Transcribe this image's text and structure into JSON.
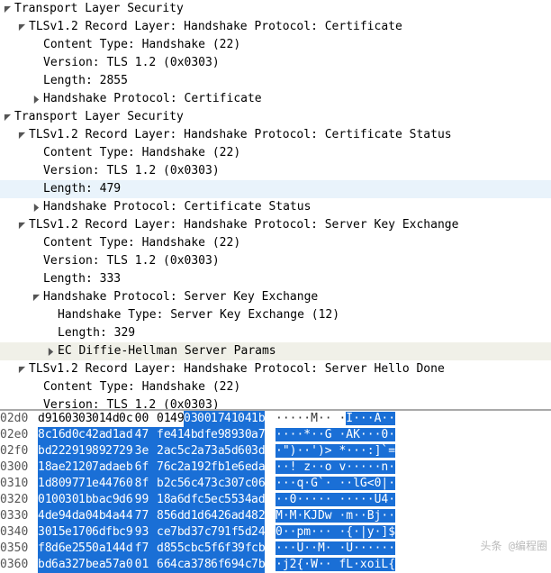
{
  "tree": {
    "n1": {
      "label": "Transport Layer Security"
    },
    "n1_1": {
      "label": "TLSv1.2 Record Layer: Handshake Protocol: Certificate"
    },
    "n1_1_ct": {
      "label": "Content Type: Handshake (22)"
    },
    "n1_1_ver": {
      "label": "Version: TLS 1.2 (0x0303)"
    },
    "n1_1_len": {
      "label": "Length: 2855"
    },
    "n1_1_hp": {
      "label": "Handshake Protocol: Certificate"
    },
    "n2": {
      "label": "Transport Layer Security"
    },
    "n2_1": {
      "label": "TLSv1.2 Record Layer: Handshake Protocol: Certificate Status"
    },
    "n2_1_ct": {
      "label": "Content Type: Handshake (22)"
    },
    "n2_1_ver": {
      "label": "Version: TLS 1.2 (0x0303)"
    },
    "n2_1_len": {
      "label": "Length: 479"
    },
    "n2_1_hp": {
      "label": "Handshake Protocol: Certificate Status"
    },
    "n2_2": {
      "label": "TLSv1.2 Record Layer: Handshake Protocol: Server Key Exchange"
    },
    "n2_2_ct": {
      "label": "Content Type: Handshake (22)"
    },
    "n2_2_ver": {
      "label": "Version: TLS 1.2 (0x0303)"
    },
    "n2_2_len": {
      "label": "Length: 333"
    },
    "n2_2_hp": {
      "label": "Handshake Protocol: Server Key Exchange"
    },
    "n2_2_ht": {
      "label": "Handshake Type: Server Key Exchange (12)"
    },
    "n2_2_hplen": {
      "label": "Length: 329"
    },
    "n2_2_ecdh": {
      "label": "EC Diffie-Hellman Server Params"
    },
    "n2_3": {
      "label": "TLSv1.2 Record Layer: Handshake Protocol: Server Hello Done"
    },
    "n2_3_ct": {
      "label": "Content Type: Handshake (22)"
    },
    "n2_3_ver": {
      "label": "Version: TLS 1.2 (0x0303)"
    }
  },
  "hex": {
    "r02d0": {
      "off": "02d0",
      "b": [
        "d9",
        "16",
        "03",
        "03",
        "01",
        "4d",
        "0c",
        "00",
        "01",
        "49",
        "03",
        "00",
        "17",
        "41",
        "04",
        "1b"
      ],
      "a": "·····M·· ·I···A··",
      "sel_from": 10
    },
    "r02e0": {
      "off": "02e0",
      "b": [
        "8c",
        "16",
        "d0",
        "c4",
        "2a",
        "d1",
        "ad",
        "47",
        "fe",
        "41",
        "4b",
        "df",
        "e9",
        "89",
        "30",
        "a7"
      ],
      "a": "····*··G ·AK···0·",
      "sel_from": 0
    },
    "r02f0": {
      "off": "02f0",
      "b": [
        "bd",
        "22",
        "29",
        "19",
        "89",
        "27",
        "29",
        "3e",
        "2a",
        "c5",
        "c2",
        "a7",
        "3a",
        "5d",
        "60",
        "3d"
      ],
      "a": "·\")··')> *···:]`=",
      "sel_from": 0
    },
    "r0300": {
      "off": "0300",
      "b": [
        "18",
        "ae",
        "21",
        "20",
        "7a",
        "da",
        "eb",
        "6f",
        "76",
        "c2",
        "a1",
        "92",
        "fb",
        "1e",
        "6e",
        "da"
      ],
      "a": "··! z··o v·····n·",
      "sel_from": 0
    },
    "r0310": {
      "off": "0310",
      "b": [
        "1d",
        "80",
        "97",
        "71",
        "e4",
        "47",
        "60",
        "8f",
        "b2",
        "c5",
        "6c",
        "47",
        "3c",
        "30",
        "7c",
        "06"
      ],
      "a": "···q·G`· ··lG<0|·",
      "sel_from": 0
    },
    "r0320": {
      "off": "0320",
      "b": [
        "01",
        "00",
        "30",
        "1b",
        "ba",
        "c9",
        "d6",
        "99",
        "18",
        "a6",
        "df",
        "c5",
        "ec",
        "55",
        "34",
        "ad"
      ],
      "a": "··0····· ·····U4·",
      "sel_from": 0
    },
    "r0330": {
      "off": "0330",
      "b": [
        "4d",
        "e9",
        "4d",
        "a0",
        "4b",
        "4a",
        "44",
        "77",
        "85",
        "6d",
        "d1",
        "d6",
        "42",
        "6a",
        "d4",
        "82"
      ],
      "a": "M·M·KJDw ·m··Bj··",
      "sel_from": 0
    },
    "r0340": {
      "off": "0340",
      "b": [
        "30",
        "15",
        "e1",
        "70",
        "6d",
        "fb",
        "c9",
        "93",
        "ce",
        "7b",
        "d3",
        "7c",
        "79",
        "1f",
        "5d",
        "24"
      ],
      "a": "0··pm··· ·{·|y·]$",
      "sel_from": 0
    },
    "r0350": {
      "off": "0350",
      "b": [
        "f8",
        "d6",
        "e2",
        "55",
        "0a",
        "14",
        "4d",
        "f7",
        "d8",
        "55",
        "cb",
        "c5",
        "f6",
        "f3",
        "9f",
        "cb"
      ],
      "a": "···U··M· ·U······",
      "sel_from": 0
    },
    "r0360": {
      "off": "0360",
      "b": [
        "bd",
        "6a",
        "32",
        "7b",
        "ea",
        "57",
        "a0",
        "01",
        "66",
        "4c",
        "a3",
        "78",
        "6f",
        "69",
        "4c",
        "7b"
      ],
      "a": "·j2{·W·· fL·xoiL{",
      "sel_from": 0
    }
  },
  "watermark_top": "头条 @编程圈",
  "watermark_bot": ""
}
